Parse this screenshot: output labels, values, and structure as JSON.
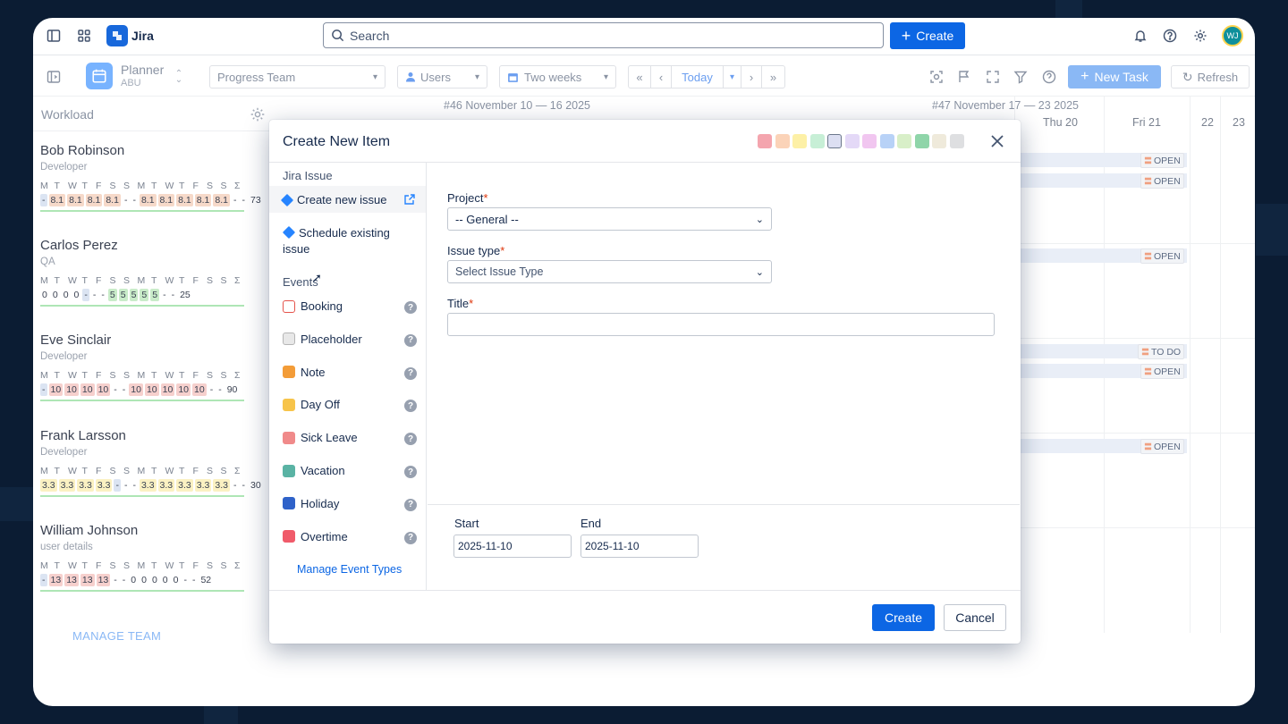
{
  "app": {
    "name": "Jira",
    "avatar_initials": "WJ"
  },
  "search": {
    "placeholder": "Search"
  },
  "topbar": {
    "create_label": "Create"
  },
  "toolbar": {
    "planner_title": "Planner",
    "planner_sub": "ABU",
    "team_select": "Progress Team",
    "users_select": "Users",
    "range_select": "Two weeks",
    "today_label": "Today",
    "new_task_label": "New Task",
    "refresh_label": "Refresh"
  },
  "sidebar": {
    "workload_label": "Workload",
    "manage_team_label": "MANAGE TEAM",
    "members": [
      {
        "name": "Bob Robinson",
        "role": "Developer",
        "days": [
          "M",
          "T",
          "W",
          "T",
          "F",
          "S",
          "S",
          "M",
          "T",
          "W",
          "T",
          "F",
          "S",
          "S",
          "Σ"
        ],
        "vals": [
          "-",
          "8.1",
          "8.1",
          "8.1",
          "8.1",
          "-",
          "-",
          "8.1",
          "8.1",
          "8.1",
          "8.1",
          "8.1",
          "-",
          "-",
          "73"
        ]
      },
      {
        "name": "Carlos Perez",
        "role": "QA",
        "days": [
          "M",
          "T",
          "W",
          "T",
          "F",
          "S",
          "S",
          "M",
          "T",
          "W",
          "T",
          "F",
          "S",
          "S",
          "Σ"
        ],
        "vals": [
          "0",
          "0",
          "0",
          "0",
          "-",
          "-",
          "-",
          "5",
          "5",
          "5",
          "5",
          "5",
          "-",
          "-",
          "25"
        ]
      },
      {
        "name": "Eve Sinclair",
        "role": "Developer",
        "days": [
          "M",
          "T",
          "W",
          "T",
          "F",
          "S",
          "S",
          "M",
          "T",
          "W",
          "T",
          "F",
          "S",
          "S",
          "Σ"
        ],
        "vals": [
          "-",
          "10",
          "10",
          "10",
          "10",
          "-",
          "-",
          "10",
          "10",
          "10",
          "10",
          "10",
          "-",
          "-",
          "90"
        ]
      },
      {
        "name": "Frank Larsson",
        "role": "Developer",
        "days": [
          "M",
          "T",
          "W",
          "T",
          "F",
          "S",
          "S",
          "M",
          "T",
          "W",
          "T",
          "F",
          "S",
          "S",
          "Σ"
        ],
        "vals": [
          "3.3",
          "3.3",
          "3.3",
          "3.3",
          "-",
          "-",
          "-",
          "3.3",
          "3.3",
          "3.3",
          "3.3",
          "3.3",
          "-",
          "-",
          "30"
        ]
      },
      {
        "name": "William Johnson",
        "role": "user details",
        "days": [
          "M",
          "T",
          "W",
          "T",
          "F",
          "S",
          "S",
          "M",
          "T",
          "W",
          "T",
          "F",
          "S",
          "S",
          "Σ"
        ],
        "vals": [
          "-",
          "13",
          "13",
          "13",
          "13",
          "-",
          "-",
          "0",
          "0",
          "0",
          "0",
          "0",
          "-",
          "-",
          "52"
        ]
      }
    ]
  },
  "calendar": {
    "week1_label": "#46 November 10 — 16 2025",
    "week2_label": "#47 November 17 — 23 2025",
    "day_headers": [
      "Thu 20",
      "Fri 21",
      "22",
      "23"
    ],
    "statuses": [
      "OPEN",
      "OPEN",
      "OPEN",
      "TO DO",
      "OPEN",
      "OPEN"
    ]
  },
  "modal": {
    "title": "Create New Item",
    "colors": [
      "#f4a5ae",
      "#fbd3b8",
      "#fdf0a6",
      "#c7efd6",
      "#dcdff2",
      "#e4d9f7",
      "#f1c6f0",
      "#b8d2f7",
      "#d8efc8",
      "#8fd5a9",
      "#efeadb",
      "#dedfe1"
    ],
    "jira_section": "Jira Issue",
    "create_new_issue": "Create new issue",
    "schedule_existing": "Schedule existing issue",
    "events_section": "Events",
    "event_types": [
      "Booking",
      "Placeholder",
      "Note",
      "Day Off",
      "Sick Leave",
      "Vacation",
      "Holiday",
      "Overtime"
    ],
    "manage_event_types": "Manage Event Types",
    "project_label": "Project",
    "project_value": "-- General --",
    "issue_type_label": "Issue type",
    "issue_type_placeholder": "Select Issue Type",
    "title_label": "Title",
    "title_value": "",
    "start_label": "Start",
    "start_value": "2025-11-10",
    "end_label": "End",
    "end_value": "2025-11-10",
    "create_button": "Create",
    "cancel_button": "Cancel"
  }
}
